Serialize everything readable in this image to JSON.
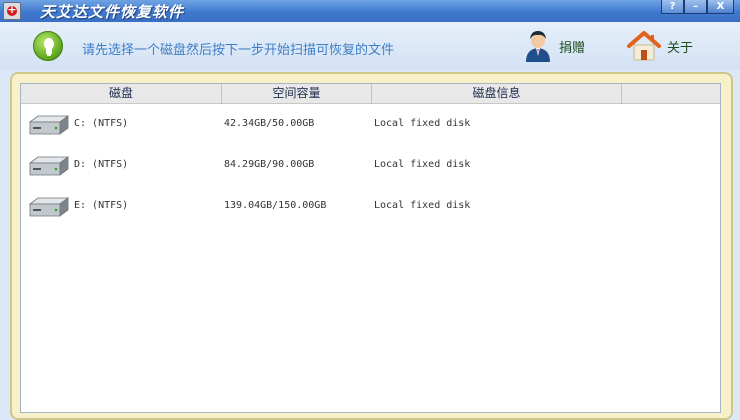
{
  "window": {
    "title": "天艾达文件恢复软件",
    "controls": {
      "help": "?",
      "minimize": "–",
      "close": "X"
    }
  },
  "header": {
    "instruction": "请先选择一个磁盘然后按下一步开始扫描可恢复的文件",
    "donate_label": "捐赠",
    "about_label": "关于"
  },
  "table": {
    "columns": [
      "磁盘",
      "空间容量",
      "磁盘信息",
      ""
    ],
    "rows": [
      {
        "name": "C: (NTFS)",
        "capacity": "42.34GB/50.00GB",
        "info": "Local fixed disk"
      },
      {
        "name": "D: (NTFS)",
        "capacity": "84.29GB/90.00GB",
        "info": "Local fixed disk"
      },
      {
        "name": "E: (NTFS)",
        "capacity": "139.04GB/150.00GB",
        "info": "Local fixed disk"
      }
    ]
  },
  "colors": {
    "titlebar": "#3f79cf",
    "instruction_text": "#3e7ec6",
    "panel_frame": "#f6f1c8"
  },
  "icons": {
    "app": "app-logo-icon",
    "tip": "lightbulb-icon",
    "donate": "person-icon",
    "about": "house-icon",
    "drive": "hard-drive-icon"
  }
}
